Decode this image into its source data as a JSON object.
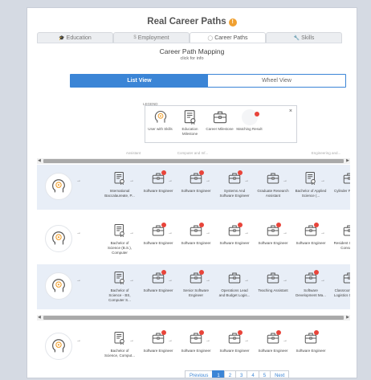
{
  "app": {
    "title": "Real Career Paths",
    "info_icon": "info-icon"
  },
  "tabs": [
    {
      "label": "Education",
      "icon": "graduation-icon",
      "active": false
    },
    {
      "label": "Employment",
      "icon": "dollar-icon",
      "active": false
    },
    {
      "label": "Career Paths",
      "icon": "user-icon",
      "active": true
    },
    {
      "label": "Skills",
      "icon": "wrench-icon",
      "active": false
    }
  ],
  "page": {
    "subtitle": "Career Path Mapping",
    "info_link": "click for info"
  },
  "view_toggle": {
    "list_label": "List View",
    "wheel_label": "Wheel View",
    "selected": "List View"
  },
  "legend": {
    "label": "LEGEND",
    "items": [
      {
        "label": "User with Skills",
        "icon": "head-icon"
      },
      {
        "label": "Education Milestone",
        "icon": "certificate-icon"
      },
      {
        "label": "Career Milestone",
        "icon": "briefcase-icon"
      },
      {
        "label": "Matching Result",
        "icon": "red-dot-icon"
      }
    ],
    "close": "×"
  },
  "faded_row": [
    "Assistant",
    "Computer and Inf...",
    "Engineering and..."
  ],
  "paths": [
    {
      "shaded": true,
      "nodes": [
        {
          "type": "education",
          "label": "International Baccalaureate, P...",
          "match": false
        },
        {
          "type": "career",
          "label": "Software Engineer",
          "match": true
        },
        {
          "type": "career",
          "label": "Software Engineer",
          "match": true
        },
        {
          "type": "career",
          "label": "Systems And Software Engineer",
          "match": true
        },
        {
          "type": "career",
          "label": "Graduate Research Assistant",
          "match": false
        },
        {
          "type": "education",
          "label": "Bachelor of Applied Science (...",
          "match": false
        },
        {
          "type": "career",
          "label": "Cylinder Processor",
          "match": false
        }
      ]
    },
    {
      "shaded": false,
      "nodes": [
        {
          "type": "education",
          "label": "Bachelor of Science (B.S.), Computer",
          "match": false
        },
        {
          "type": "career",
          "label": "Software Engineer",
          "match": true
        },
        {
          "type": "career",
          "label": "Software Engineer",
          "match": true
        },
        {
          "type": "career",
          "label": "Software Engineer",
          "match": true
        },
        {
          "type": "career",
          "label": "Software Engineer",
          "match": true
        },
        {
          "type": "career",
          "label": "Software Engineer",
          "match": true
        },
        {
          "type": "career",
          "label": "Resident Computer Consultant",
          "match": false
        }
      ]
    },
    {
      "shaded": true,
      "nodes": [
        {
          "type": "education",
          "label": "Bachelor of Science - BS, Computer S...",
          "match": false
        },
        {
          "type": "career",
          "label": "Software Engineer",
          "match": true
        },
        {
          "type": "career",
          "label": "Senior Software Engineer",
          "match": true
        },
        {
          "type": "career",
          "label": "Operations Lead and Budget Logis...",
          "match": false
        },
        {
          "type": "career",
          "label": "Teaching Assistant",
          "match": false
        },
        {
          "type": "career",
          "label": "Software Development Ma...",
          "match": true
        },
        {
          "type": "career",
          "label": "Classroom Project Logistics Coordin...",
          "match": false
        }
      ]
    },
    {
      "shaded": false,
      "nodes": [
        {
          "type": "education",
          "label": "Bachelor of Science, Comput...",
          "match": false
        },
        {
          "type": "career",
          "label": "Software Engineer",
          "match": true
        },
        {
          "type": "career",
          "label": "Software Engineer",
          "match": true
        },
        {
          "type": "career",
          "label": "Software Engineer",
          "match": true
        },
        {
          "type": "career",
          "label": "Software Engineer",
          "match": true
        },
        {
          "type": "career",
          "label": "Software Engineer",
          "match": true
        }
      ]
    }
  ],
  "pagination": {
    "previous": "Previous",
    "pages": [
      "1",
      "2",
      "3",
      "4",
      "5"
    ],
    "current": "1",
    "next": "Next"
  },
  "colors": {
    "accent": "#3b85d6",
    "match_dot": "#e8443a",
    "row_shade": "#e8eef7",
    "badge": "#f0a030"
  }
}
